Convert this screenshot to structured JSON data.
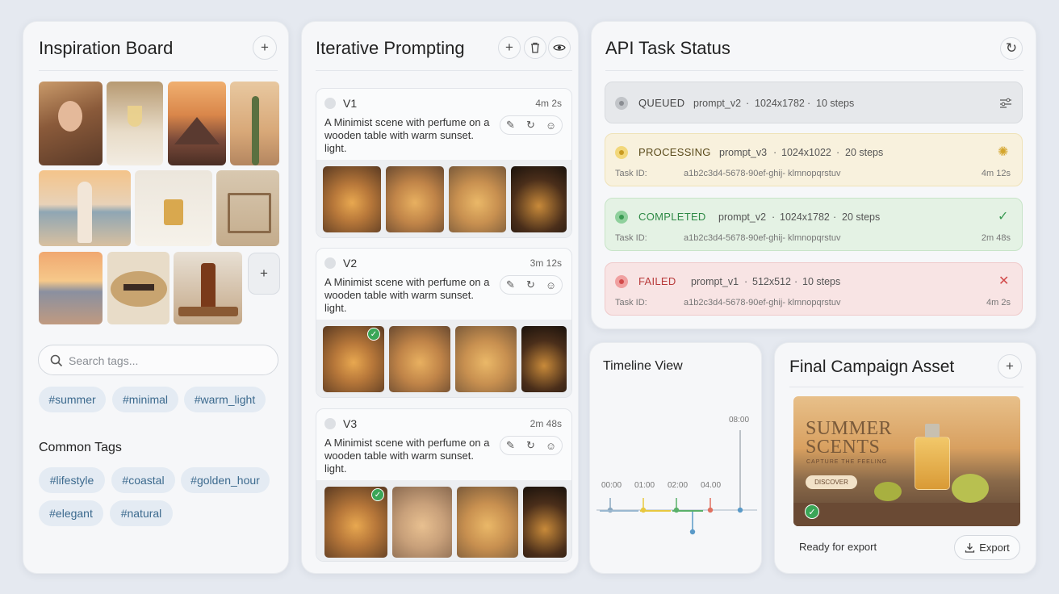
{
  "inspiration": {
    "title": "Inspiration Board",
    "search_placeholder": "Search tags...",
    "selected_tags": [
      "#summer",
      "#minimal",
      "#warm_light"
    ],
    "common_title": "Common Tags",
    "common_tags": [
      "#lifestyle",
      "#coastal",
      "#golden_hour",
      "#elegant",
      "#natural"
    ]
  },
  "prompting": {
    "title": "Iterative Prompting",
    "versions": [
      {
        "label": "V1",
        "time": "4m 2s",
        "text": "A Minimist scene with perfume on a wooden table with warm sunset. light."
      },
      {
        "label": "V2",
        "time": "3m 12s",
        "text": "A Minimist scene with perfume on a wooden table with warm sunset. light."
      },
      {
        "label": "V3",
        "time": "2m 48s",
        "text": "A Minimist scene with perfume on a wooden table with warm sunset. light."
      }
    ]
  },
  "api": {
    "title": "API Task Status",
    "tasks": [
      {
        "status": "QUEUED",
        "prompt": "prompt_v2",
        "size": "1024x1782",
        "steps": "10 steps",
        "id_label": "",
        "id": "",
        "time": "",
        "color": "#8a8d92"
      },
      {
        "status": "PROCESSING",
        "prompt": "prompt_v3",
        "size": "1024x1022",
        "steps": "20 steps",
        "id_label": "Task ID:",
        "id": "a1b2c3d4-5678-90ef-ghij- klmnopqrstuv",
        "time": "4m 12s",
        "color": "#c99a22"
      },
      {
        "status": "COMPLETED",
        "prompt": "prompt_v2",
        "size": "1024x1782",
        "steps": "20 steps",
        "id_label": "Task ID:",
        "id": "a1b2c3d4-5678-90ef-ghij- klmnopqrstuv",
        "time": "2m 48s",
        "color": "#3a9a52"
      },
      {
        "status": "FAILED",
        "prompt": "prompt_v1",
        "size": "512x512",
        "steps": "10 steps",
        "id_label": "Task ID:",
        "id": "a1b2c3d4-5678-90ef-ghij- klmnopqrstuv",
        "time": "4m 2s",
        "color": "#d24a4a"
      }
    ]
  },
  "timeline": {
    "title": "Timeline View",
    "labels": [
      "00:00",
      "01:00",
      "02:00",
      "04.00",
      "08:00"
    ]
  },
  "final": {
    "title": "Final Campaign Asset",
    "headline1": "SUMMER",
    "headline2": "SCENTS",
    "subline": "CAPTURE THE FEELING",
    "cta": "DISCOVER",
    "status": "Ready for export",
    "export_label": "Export"
  },
  "icons": [
    "plus-icon",
    "trash-icon",
    "eye-icon",
    "refresh-icon",
    "search-icon",
    "pencil-icon",
    "smiley-icon",
    "check-icon",
    "close-icon",
    "download-icon",
    "sliders-icon",
    "spinner-icon"
  ]
}
